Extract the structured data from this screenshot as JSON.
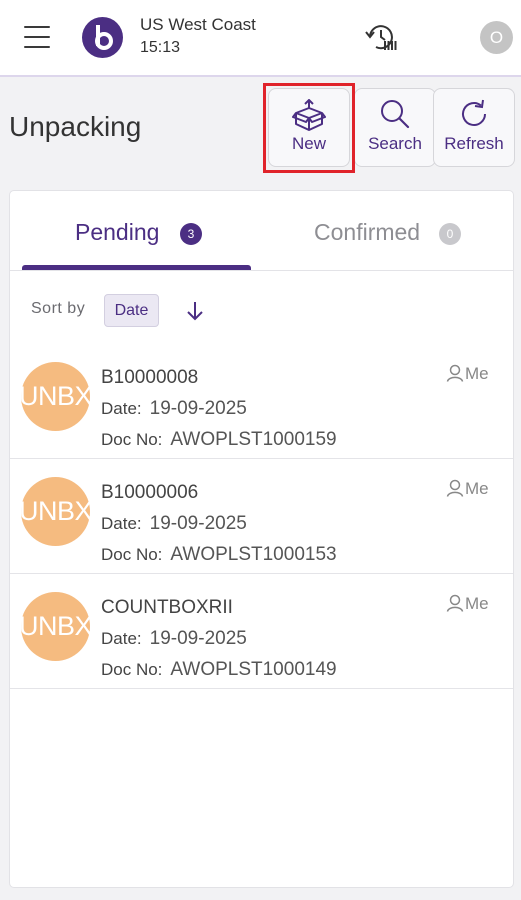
{
  "header": {
    "region": "US West Coast",
    "time": "15:13",
    "user_initial": "O",
    "icons": {
      "menu": "hamburger-icon",
      "logo": "brand-logo",
      "history": "history-icon"
    }
  },
  "page": {
    "title": "Unpacking"
  },
  "actions": {
    "new_label": "New",
    "search_label": "Search",
    "refresh_label": "Refresh"
  },
  "tabs": [
    {
      "label": "Pending",
      "count": "3",
      "active": true
    },
    {
      "label": "Confirmed",
      "count": "0",
      "active": false
    }
  ],
  "sort": {
    "label": "Sort by",
    "field": "Date",
    "direction": "descending"
  },
  "labels": {
    "date": "Date:",
    "doc_no": "Doc No:"
  },
  "documents": [
    {
      "avatar": "UNBX",
      "code": "B10000008",
      "date": "19-09-2025",
      "doc_no": "AWOPLST1000159",
      "owner": "Me"
    },
    {
      "avatar": "UNBX",
      "code": "B10000006",
      "date": "19-09-2025",
      "doc_no": "AWOPLST1000153",
      "owner": "Me"
    },
    {
      "avatar": "UNBX",
      "code": "COUNTBOXRII",
      "date": "19-09-2025",
      "doc_no": "AWOPLST1000149",
      "owner": "Me"
    }
  ],
  "colors": {
    "accent": "#4b2e83",
    "avatar": "#f5bb80",
    "highlight": "#e0232a",
    "badge_inactive": "#c8c8cc"
  }
}
